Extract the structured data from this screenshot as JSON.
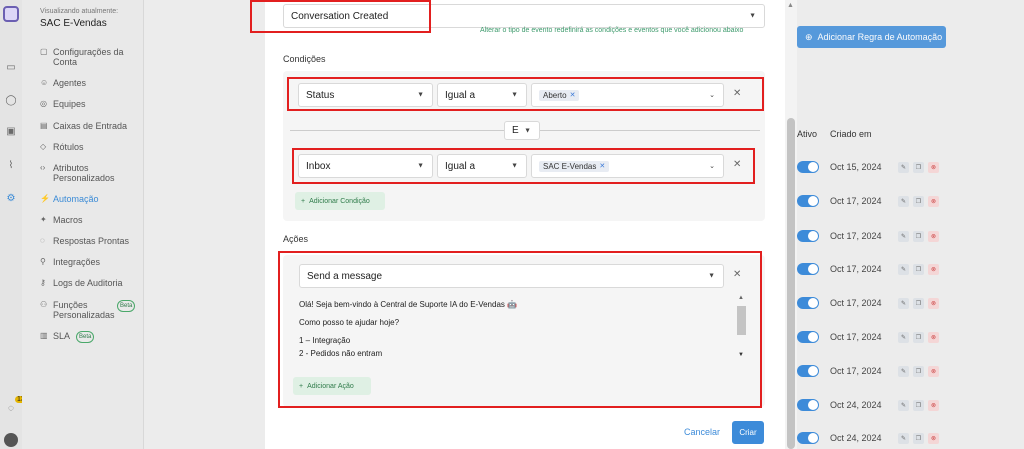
{
  "sidebar": {
    "account_label": "Visualizando atualmente:",
    "account_name": "SAC E-Vendas",
    "items": [
      {
        "label": "Configurações da Conta"
      },
      {
        "label": "Agentes"
      },
      {
        "label": "Equipes"
      },
      {
        "label": "Caixas de Entrada"
      },
      {
        "label": "Rótulos"
      },
      {
        "label": "Atributos Personalizados"
      },
      {
        "label": "Automação"
      },
      {
        "label": "Macros"
      },
      {
        "label": "Respostas Prontas"
      },
      {
        "label": "Integrações"
      },
      {
        "label": "Logs de Auditoria"
      },
      {
        "label": "Funções Personalizadas"
      },
      {
        "label": "SLA"
      }
    ],
    "beta_label": "Beta",
    "notification_count": "13"
  },
  "background": {
    "add_rule_label": "Adicionar Regra de Automação",
    "col_active": "Ativo",
    "col_created": "Criado em",
    "rows": [
      {
        "date": "Oct 15, 2024"
      },
      {
        "date": "Oct 17, 2024"
      },
      {
        "date": "Oct 17, 2024"
      },
      {
        "date": "Oct 17, 2024"
      },
      {
        "date": "Oct 17, 2024"
      },
      {
        "date": "Oct 17, 2024"
      },
      {
        "date": "Oct 17, 2024"
      },
      {
        "date": "Oct 24, 2024"
      },
      {
        "date": "Oct 24, 2024"
      }
    ]
  },
  "modal": {
    "event_value": "Conversation Created",
    "event_hint": "Alterar o tipo de evento redefinirá as condições e eventos que você adicionou abaixo",
    "conditions_label": "Condições",
    "condition1": {
      "field": "Status",
      "operator": "Igual a",
      "value_chip": "Aberto"
    },
    "join_operator": "E",
    "condition2": {
      "field": "Inbox",
      "operator": "Igual a",
      "value_chip": "SAC E-Vendas"
    },
    "add_condition_label": "Adicionar Condição",
    "actions_label": "Ações",
    "action_type": "Send a message",
    "message_lines": [
      "Olá! Seja bem-vindo à Central de Suporte IA do E-Vendas 🤖",
      "Como posso te ajudar hoje?",
      "1 – Integração",
      "2 - Pedidos não entram"
    ],
    "add_action_label": "Adicionar Ação",
    "cancel_label": "Cancelar",
    "create_label": "Criar"
  }
}
